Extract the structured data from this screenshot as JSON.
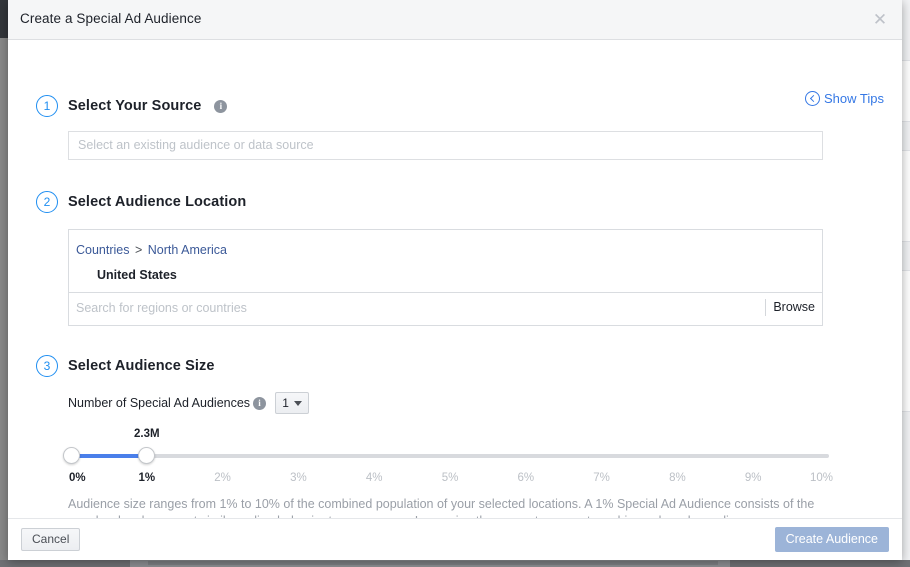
{
  "dialog": {
    "title": "Create a Special Ad Audience",
    "close_icon": "close-icon",
    "show_tips": {
      "label": "Show Tips",
      "icon": "circle-chevron-left-icon"
    }
  },
  "steps": {
    "source": {
      "number": "1",
      "title": "Select Your Source",
      "info_icon": "i",
      "input_placeholder": "Select an existing audience or data source",
      "input_value": ""
    },
    "location": {
      "number": "2",
      "title": "Select Audience Location",
      "breadcrumb": {
        "root": "Countries",
        "separator": ">",
        "current": "North America"
      },
      "selected": "United States",
      "search_placeholder": "Search for regions or countries",
      "search_value": "",
      "browse_label": "Browse"
    },
    "size": {
      "number": "3",
      "title": "Select Audience Size",
      "count_label": "Number of Special Ad Audiences",
      "count_info_icon": "i",
      "count_value": "1",
      "caret_icon": "caret-down-icon",
      "slider": {
        "value_label": "2.3M",
        "lower_percent": 0,
        "upper_percent": 1,
        "min_percent": 0,
        "max_percent": 10,
        "ticks": [
          "0%",
          "1%",
          "2%",
          "3%",
          "4%",
          "5%",
          "6%",
          "7%",
          "8%",
          "9%",
          "10%"
        ],
        "active_ticks": [
          "0%",
          "1%"
        ],
        "fill_color": "#4a7fea",
        "track_color": "#d8dade"
      },
      "description": "Audience size ranges from 1% to 10% of the combined population of your selected locations. A 1% Special Ad Audience consists of the people who share most similar online behavior to your source. Increasing the percentage creates a bigger, broader audience."
    }
  },
  "footer": {
    "cancel_label": "Cancel",
    "create_label": "Create Audience",
    "create_enabled": false,
    "create_color": "#9cb4d8"
  },
  "theme": {
    "accent": "#1f8ef1",
    "link": "#3578E5",
    "header_bg": "#f5f6f7",
    "backdrop": "#3a3d42"
  }
}
